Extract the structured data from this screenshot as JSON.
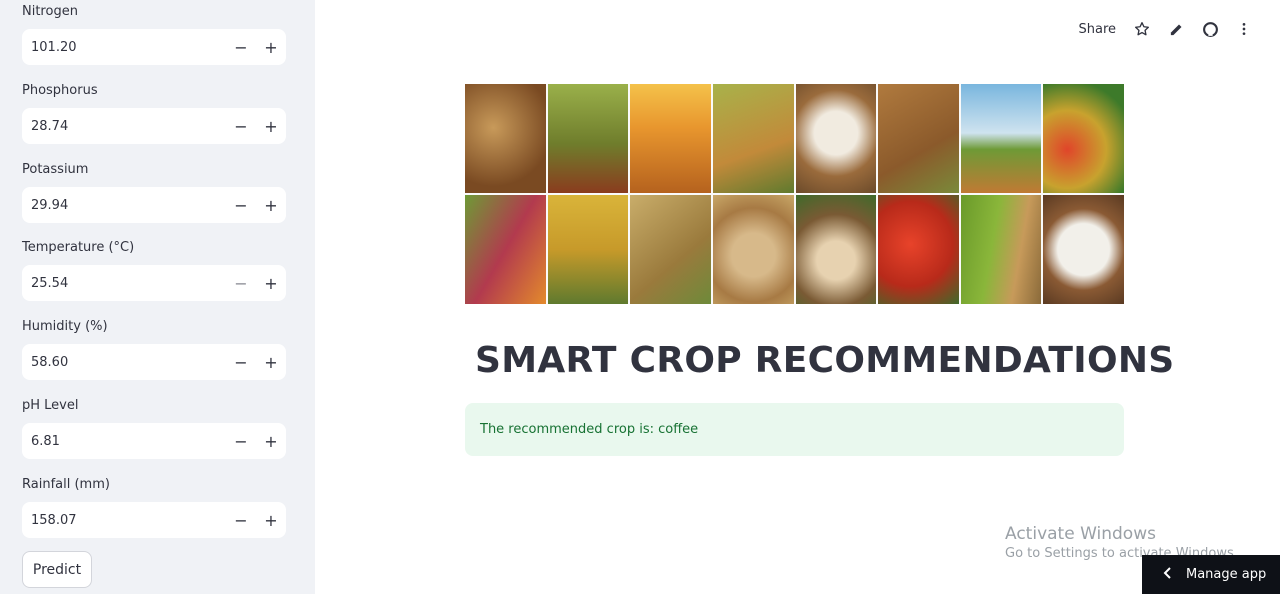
{
  "sidebar": {
    "fields": [
      {
        "label": "Nitrogen",
        "value": "101.20"
      },
      {
        "label": "Phosphorus",
        "value": "28.74"
      },
      {
        "label": "Potassium",
        "value": "29.94"
      },
      {
        "label": "Temperature (°C)",
        "value": "25.54"
      },
      {
        "label": "Humidity (%)",
        "value": "58.60"
      },
      {
        "label": "pH Level",
        "value": "6.81"
      },
      {
        "label": "Rainfall (mm)",
        "value": "158.07"
      }
    ],
    "minus_symbol": "−",
    "plus_symbol": "+",
    "predict_label": "Predict"
  },
  "toolbar": {
    "share_label": "Share",
    "icons": [
      "star-icon",
      "pencil-icon",
      "github-icon",
      "more-vertical-icon"
    ]
  },
  "main": {
    "title": "SMART CROP RECOMMENDATIONS",
    "result": "The recommended crop is: coffee"
  },
  "watermark": {
    "line1": "Activate Windows",
    "line2": "Go to Settings to activate Windows."
  },
  "manage_app": {
    "label": "Manage app"
  },
  "colors": {
    "sidebar_bg": "#f0f2f6",
    "success_bg": "#e9f8ee",
    "success_text": "#177233",
    "manage_bg": "#0e1117"
  }
}
